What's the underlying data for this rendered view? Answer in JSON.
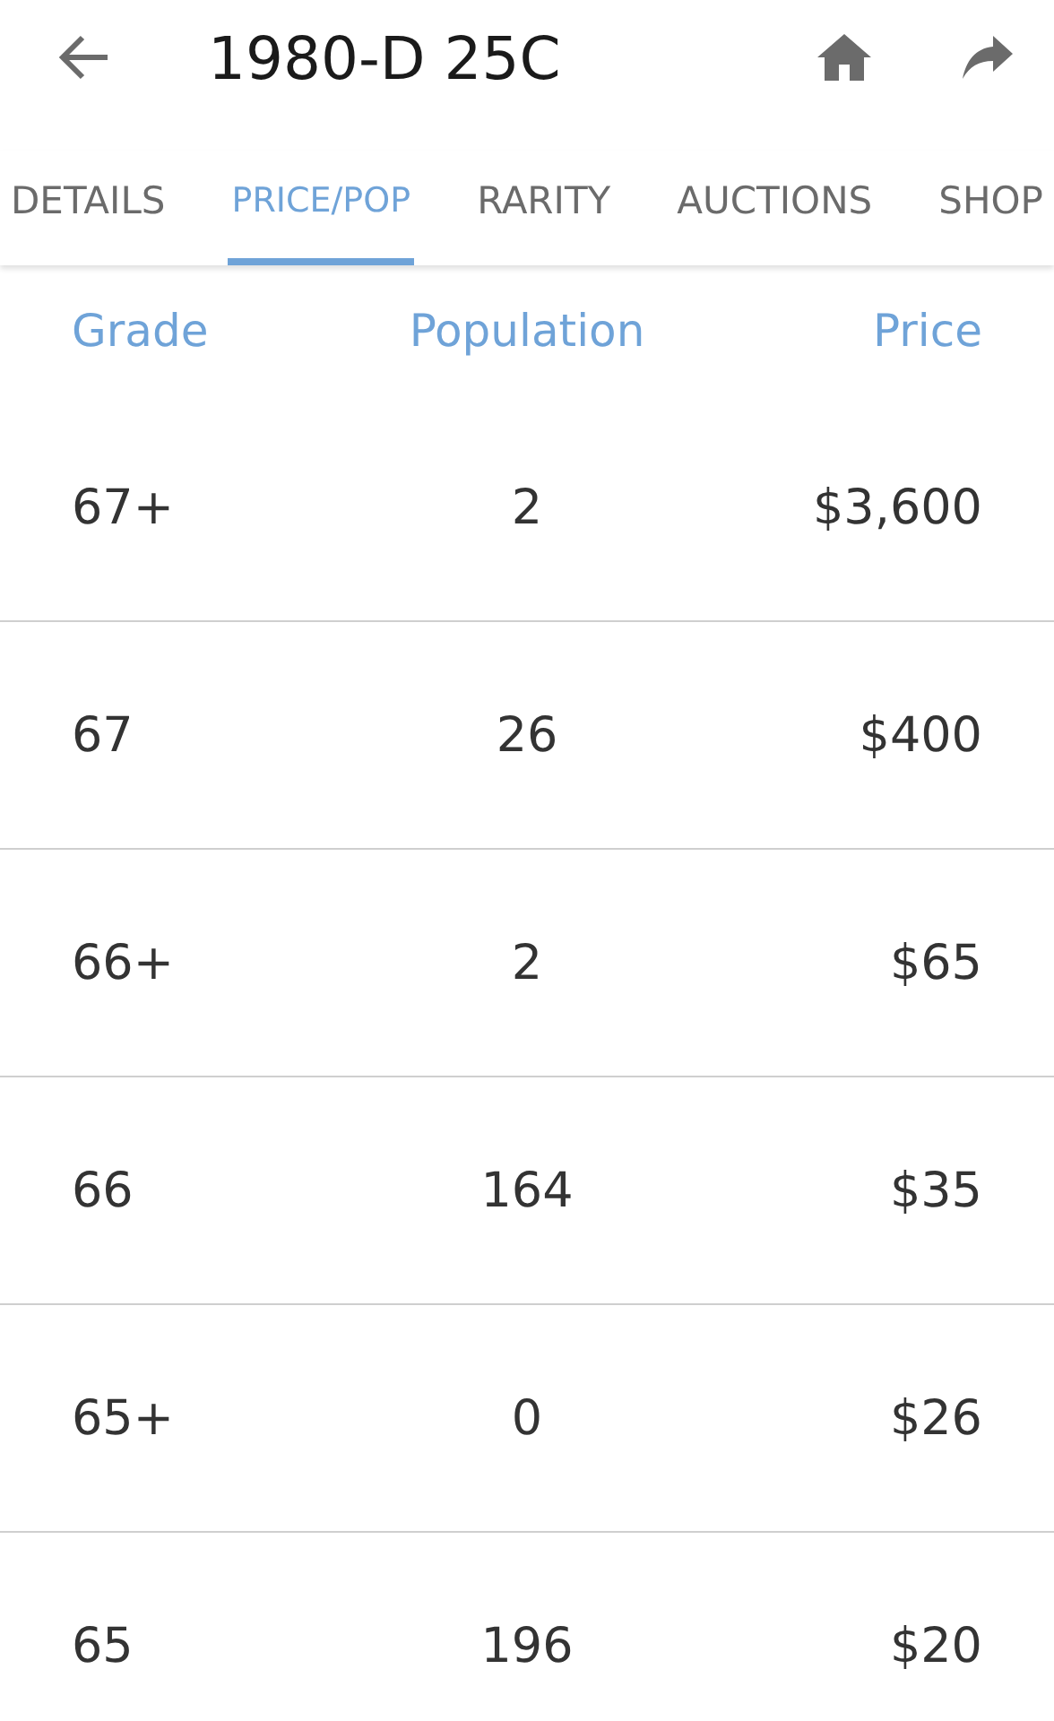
{
  "app_bar": {
    "title": "1980-D 25C"
  },
  "tabs": [
    {
      "label": "DETAILS",
      "selected": false
    },
    {
      "label": "PRICE/POP",
      "selected": true
    },
    {
      "label": "RARITY",
      "selected": false
    },
    {
      "label": "AUCTIONS",
      "selected": false
    },
    {
      "label": "SHOP",
      "selected": false
    }
  ],
  "table": {
    "columns": [
      "Grade",
      "Population",
      "Price"
    ],
    "rows": [
      [
        "67+",
        "2",
        "$3,600"
      ],
      [
        "67",
        "26",
        "$400"
      ],
      [
        "66+",
        "2",
        "$65"
      ],
      [
        "66",
        "164",
        "$35"
      ],
      [
        "65+",
        "0",
        "$26"
      ],
      [
        "65",
        "196",
        "$20"
      ]
    ]
  }
}
